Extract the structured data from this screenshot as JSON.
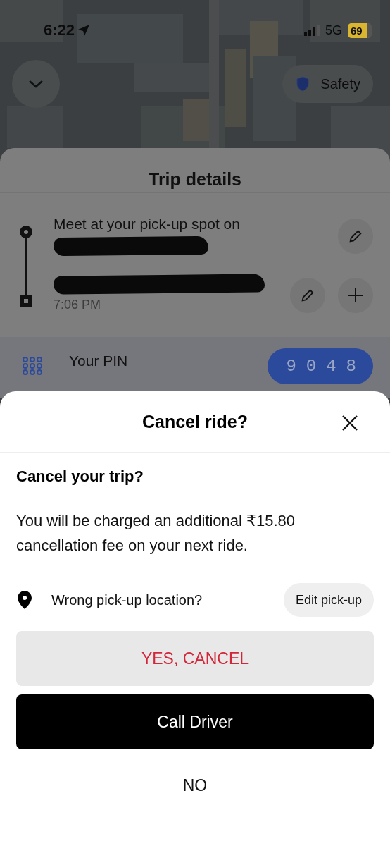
{
  "status_bar": {
    "time": "6:22",
    "network": "5G",
    "battery": "69"
  },
  "safety_button": {
    "label": "Safety"
  },
  "trip_details": {
    "title": "Trip details",
    "stops": [
      {
        "kind": "pickup",
        "text": "Meet at your pick-up spot on",
        "actions": [
          {
            "kind": "edit"
          }
        ]
      },
      {
        "kind": "dropoff",
        "time": "7:06 PM",
        "actions": [
          {
            "kind": "edit"
          },
          {
            "kind": "add"
          }
        ]
      }
    ],
    "pin": {
      "label": "Your PIN",
      "code": "9048"
    }
  },
  "dialog": {
    "title": "Cancel ride?",
    "heading": "Cancel your trip?",
    "message": "You will be charged an additional ₹15.80 cancellation fee on your next ride.",
    "pickup_prompt": "Wrong pick-up location?",
    "edit_button": "Edit pick-up",
    "buttons": [
      {
        "label": "YES, CANCEL",
        "kind": "destructive"
      },
      {
        "label": "Call Driver",
        "kind": "primary"
      },
      {
        "label": "NO",
        "kind": "plain"
      }
    ]
  }
}
